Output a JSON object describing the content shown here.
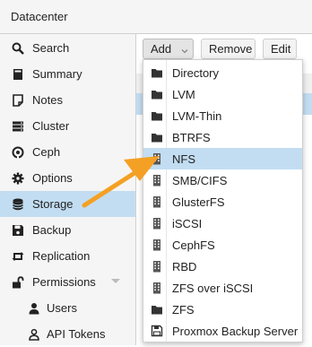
{
  "header": {
    "title": "Datacenter"
  },
  "sidebar": {
    "items": [
      {
        "label": "Search",
        "icon": "search-icon"
      },
      {
        "label": "Summary",
        "icon": "book-icon"
      },
      {
        "label": "Notes",
        "icon": "notes-icon"
      },
      {
        "label": "Cluster",
        "icon": "server-icon"
      },
      {
        "label": "Ceph",
        "icon": "ceph-icon"
      },
      {
        "label": "Options",
        "icon": "gear-icon"
      },
      {
        "label": "Storage",
        "icon": "database-icon",
        "selected": true
      },
      {
        "label": "Backup",
        "icon": "floppy-icon"
      },
      {
        "label": "Replication",
        "icon": "retweet-icon"
      },
      {
        "label": "Permissions",
        "icon": "unlock-icon"
      },
      {
        "label": "Users",
        "icon": "user-icon"
      },
      {
        "label": "API Tokens",
        "icon": "user-o-icon"
      }
    ]
  },
  "toolbar": {
    "add_label": "Add",
    "remove_label": "Remove",
    "edit_label": "Edit"
  },
  "menu": {
    "items": [
      {
        "label": "Directory",
        "icon": "folder-icon"
      },
      {
        "label": "LVM",
        "icon": "folder-icon"
      },
      {
        "label": "LVM-Thin",
        "icon": "folder-icon"
      },
      {
        "label": "BTRFS",
        "icon": "folder-icon"
      },
      {
        "label": "NFS",
        "icon": "building-icon",
        "hover": true
      },
      {
        "label": "SMB/CIFS",
        "icon": "building-icon"
      },
      {
        "label": "GlusterFS",
        "icon": "building-icon"
      },
      {
        "label": "iSCSI",
        "icon": "building-icon"
      },
      {
        "label": "CephFS",
        "icon": "building-icon"
      },
      {
        "label": "RBD",
        "icon": "building-icon"
      },
      {
        "label": "ZFS over iSCSI",
        "icon": "building-icon"
      },
      {
        "label": "ZFS",
        "icon": "folder-icon"
      },
      {
        "label": "Proxmox Backup Server",
        "icon": "floppy-o-icon"
      }
    ]
  },
  "colors": {
    "selection": "#c2ddf2",
    "arrow": "#f4a024"
  }
}
